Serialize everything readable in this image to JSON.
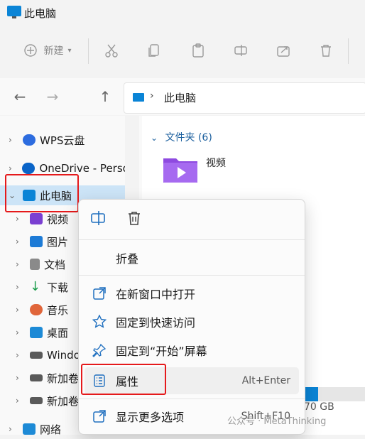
{
  "window": {
    "title": "此电脑"
  },
  "toolbar": {
    "new_label": "新建",
    "icons": [
      "new-icon",
      "cut-icon",
      "copy-icon",
      "paste-icon",
      "rename-icon",
      "share-icon",
      "delete-icon"
    ]
  },
  "nav": {
    "address": "此电脑"
  },
  "tree": [
    {
      "label": "WPS云盘",
      "icon": "cloud-icon",
      "color": "#2d6cdf"
    },
    {
      "label": "OneDrive - Perso",
      "icon": "onedrive-icon",
      "color": "#0a64c8"
    },
    {
      "label": "此电脑",
      "icon": "pc-icon",
      "color": "#0a84d6"
    },
    {
      "label": "视频",
      "icon": "video-icon",
      "color": "#7a3fd1"
    },
    {
      "label": "图片",
      "icon": "pictures-icon",
      "color": "#1d7bd6"
    },
    {
      "label": "文档",
      "icon": "documents-icon",
      "color": "#8a8a8a"
    },
    {
      "label": "下载",
      "icon": "download-icon",
      "color": "#1a9c4b"
    },
    {
      "label": "音乐",
      "icon": "music-icon",
      "color": "#e0653a"
    },
    {
      "label": "桌面",
      "icon": "desktop-icon",
      "color": "#1d8ad6"
    },
    {
      "label": "Windo",
      "icon": "drive-icon",
      "color": "#5a5a5a"
    },
    {
      "label": "新加卷",
      "icon": "drive-icon",
      "color": "#5a5a5a"
    },
    {
      "label": "新加卷",
      "icon": "drive-icon",
      "color": "#5a5a5a"
    },
    {
      "label": "网络",
      "icon": "network-icon",
      "color": "#1d8ad6"
    }
  ],
  "content": {
    "section_header": "文件夹 (6)",
    "folder_label": "视频",
    "drive_size_fragment": "70 GB",
    "drive_fill_fraction": 0.26
  },
  "context_menu": {
    "items": [
      {
        "label": "折叠",
        "shortcut": ""
      },
      {
        "label": "在新窗口中打开",
        "shortcut": ""
      },
      {
        "label": "固定到快速访问",
        "shortcut": ""
      },
      {
        "label": "固定到“开始”屏幕",
        "shortcut": ""
      },
      {
        "label": "属性",
        "shortcut": "Alt+Enter"
      },
      {
        "label": "显示更多选项",
        "shortcut": "Shift+F10"
      }
    ]
  },
  "watermark": "公众号 · MetaThinking",
  "colors": {
    "accent": "#0a84d6",
    "highlight": "#e5191b",
    "selected_bg": "#cce4f7"
  }
}
